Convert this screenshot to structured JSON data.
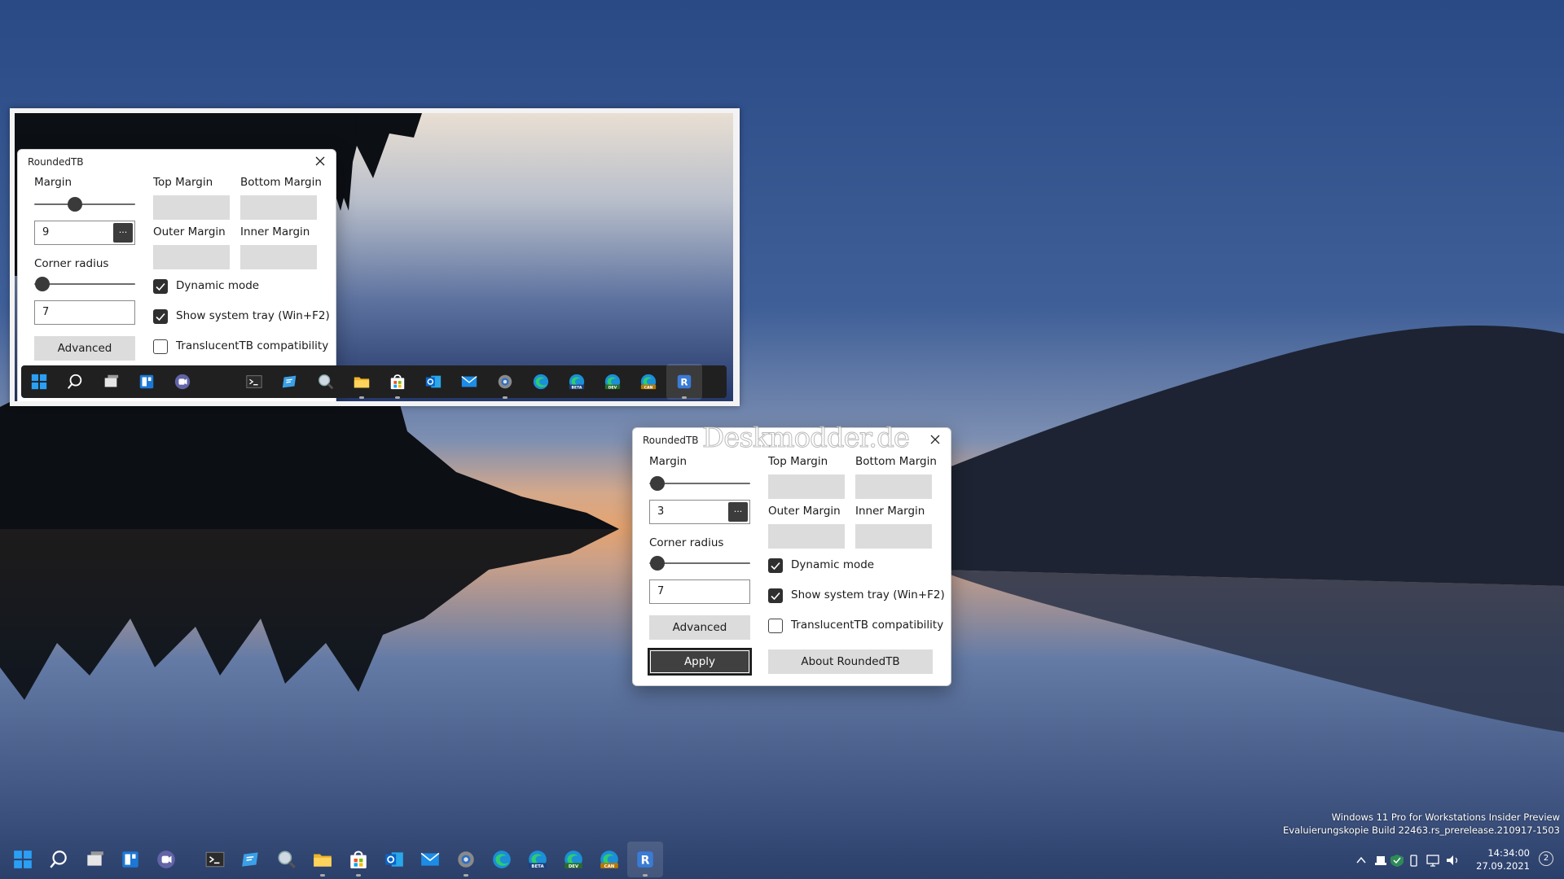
{
  "dialog_small": {
    "title": "RoundedTB",
    "margin_label": "Margin",
    "margin_value": "9",
    "margin_slider_level": 0.4,
    "more_button": "...",
    "corner_label": "Corner radius",
    "corner_value": "7",
    "corner_slider_level": 0.08,
    "advanced_label": "Advanced",
    "top_margin_label": "Top Margin",
    "bottom_margin_label": "Bottom Margin",
    "outer_margin_label": "Outer Margin",
    "inner_margin_label": "Inner Margin",
    "dynamic_mode_label": "Dynamic mode",
    "dynamic_mode_checked": true,
    "system_tray_label": "Show system tray (Win+F2)",
    "system_tray_checked": true,
    "translucent_label": "TranslucentTB compatibility",
    "translucent_checked": false
  },
  "dialog_main": {
    "title": "RoundedTB",
    "margin_label": "Margin",
    "margin_value": "3",
    "margin_slider_level": 0.08,
    "more_button": "...",
    "corner_label": "Corner radius",
    "corner_value": "7",
    "corner_slider_level": 0.08,
    "advanced_label": "Advanced",
    "apply_label": "Apply",
    "about_label": "About RoundedTB",
    "top_margin_label": "Top Margin",
    "bottom_margin_label": "Bottom Margin",
    "outer_margin_label": "Outer Margin",
    "inner_margin_label": "Inner Margin",
    "dynamic_mode_label": "Dynamic mode",
    "dynamic_mode_checked": true,
    "system_tray_label": "Show system tray (Win+F2)",
    "system_tray_checked": true,
    "translucent_label": "TranslucentTB compatibility",
    "translucent_checked": false
  },
  "watermark": "Deskmodder.de",
  "taskbar": {
    "icons": [
      "start-icon",
      "search-icon",
      "task-view-icon",
      "widgets-icon",
      "teams-chat-icon",
      "terminal-icon",
      "remote-desktop-icon",
      "magnifier-icon",
      "file-explorer-icon",
      "microsoft-store-icon",
      "outlook-icon",
      "mail-icon",
      "settings-icon",
      "edge-icon",
      "edge-beta-icon",
      "edge-dev-icon",
      "edge-canary-icon",
      "roundedtb-icon"
    ],
    "edge_beta_badge": "BETA",
    "edge_dev_badge": "DEV",
    "edge_canary_badge": "CAN",
    "roundedtb_letter": "R"
  },
  "system": {
    "os_line1": "Windows 11 Pro for Workstations Insider Preview",
    "os_line2": "Evaluierungskopie Build 22463.rs_prerelease.210917-1503",
    "time": "14:34:00",
    "date": "27.09.2021",
    "notification_count": "2"
  }
}
